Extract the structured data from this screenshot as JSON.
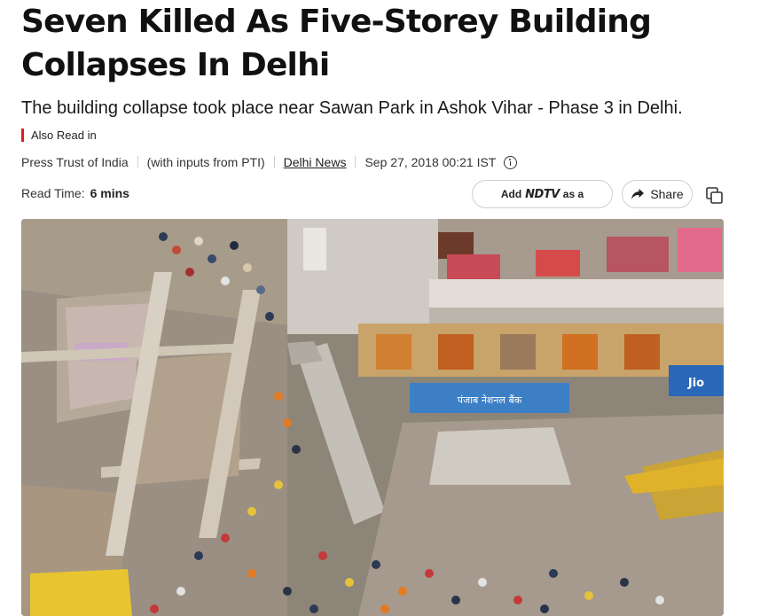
{
  "article": {
    "headline": "Seven Killed As Five-Storey Building Collapses In Delhi",
    "subheadline": "The building collapse took place near Sawan Park in Ashok Vihar - Phase 3 in Delhi.",
    "also_read_label": "Also Read in",
    "meta": {
      "author": "Press Trust of India",
      "inputs_note": "(with inputs from PTI)",
      "category": "Delhi News",
      "timestamp": "Sep 27, 2018 00:21 IST"
    },
    "read_time_label": "Read Time:",
    "read_time_value": "6 mins"
  },
  "actions": {
    "add_prefix": "Add",
    "add_brand": "NDTV",
    "add_suffix": "as a",
    "share_label": "Share"
  },
  "hero_image": {
    "signs": {
      "bank": "पंजाब नेशनल बैंक",
      "jio": "Jio"
    }
  },
  "colors": {
    "accent": "#e21b22",
    "text": "#1a1a1a",
    "border": "#cfcfcf"
  },
  "icons": {
    "info": "info-icon",
    "share": "share-arrow-icon",
    "copy": "copy-icon"
  }
}
